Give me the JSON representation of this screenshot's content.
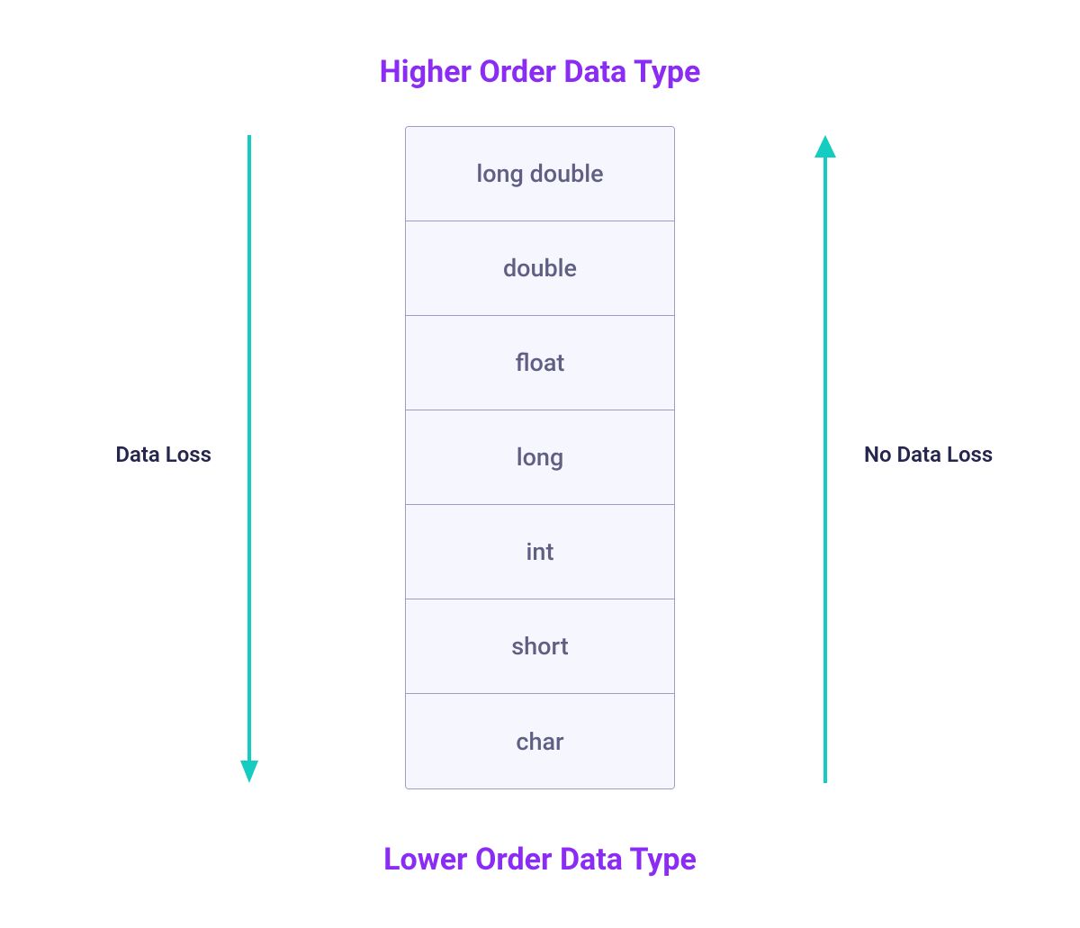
{
  "titles": {
    "top": "Higher Order Data Type",
    "bottom": "Lower Order Data Type"
  },
  "labels": {
    "left": "Data Loss",
    "right": "No Data Loss"
  },
  "types": {
    "t0": "long double",
    "t1": "double",
    "t2": "float",
    "t3": "long",
    "t4": "int",
    "t5": "short",
    "t6": "char"
  },
  "colors": {
    "accent_arrow": "#14CCC0",
    "title": "#8B2CF5",
    "row_bg": "#f6f6fe",
    "row_border": "#9d9cc7",
    "row_text": "#605f83",
    "label_text": "#25254d"
  }
}
